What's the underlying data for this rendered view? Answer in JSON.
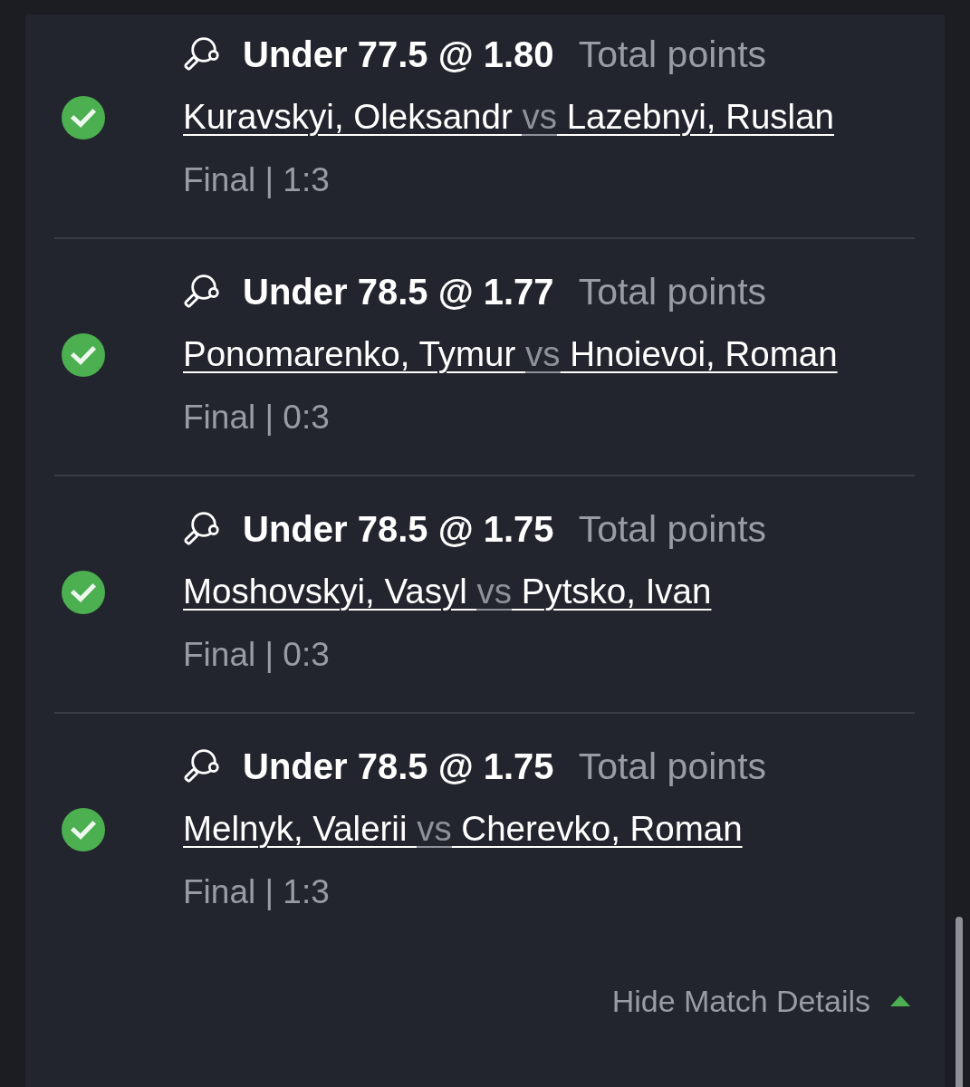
{
  "selections": [
    {
      "won": true,
      "market_line": "Under 77.5 @ 1.80",
      "market": "Total points",
      "players": [
        "Kuravskyi, Oleksandr",
        "Lazebnyi, Ruslan"
      ],
      "separator": "vs",
      "status": "Final | 1:3"
    },
    {
      "won": true,
      "market_line": "Under 78.5 @ 1.77",
      "market": "Total points",
      "players": [
        "Ponomarenko, Tymur",
        "Hnoievoi, Roman"
      ],
      "separator": "vs",
      "status": "Final | 0:3"
    },
    {
      "won": true,
      "market_line": "Under 78.5 @ 1.75",
      "market": "Total points",
      "players": [
        "Moshovskyi, Vasyl",
        "Pytsko, Ivan"
      ],
      "separator": "vs",
      "status": "Final | 0:3"
    },
    {
      "won": true,
      "market_line": "Under 78.5 @ 1.75",
      "market": "Total points",
      "players": [
        "Melnyk, Valerii",
        "Cherevko, Roman"
      ],
      "separator": "vs",
      "status": "Final | 1:3"
    }
  ],
  "details_toggle": {
    "label": "Hide Match Details",
    "expanded": true
  }
}
